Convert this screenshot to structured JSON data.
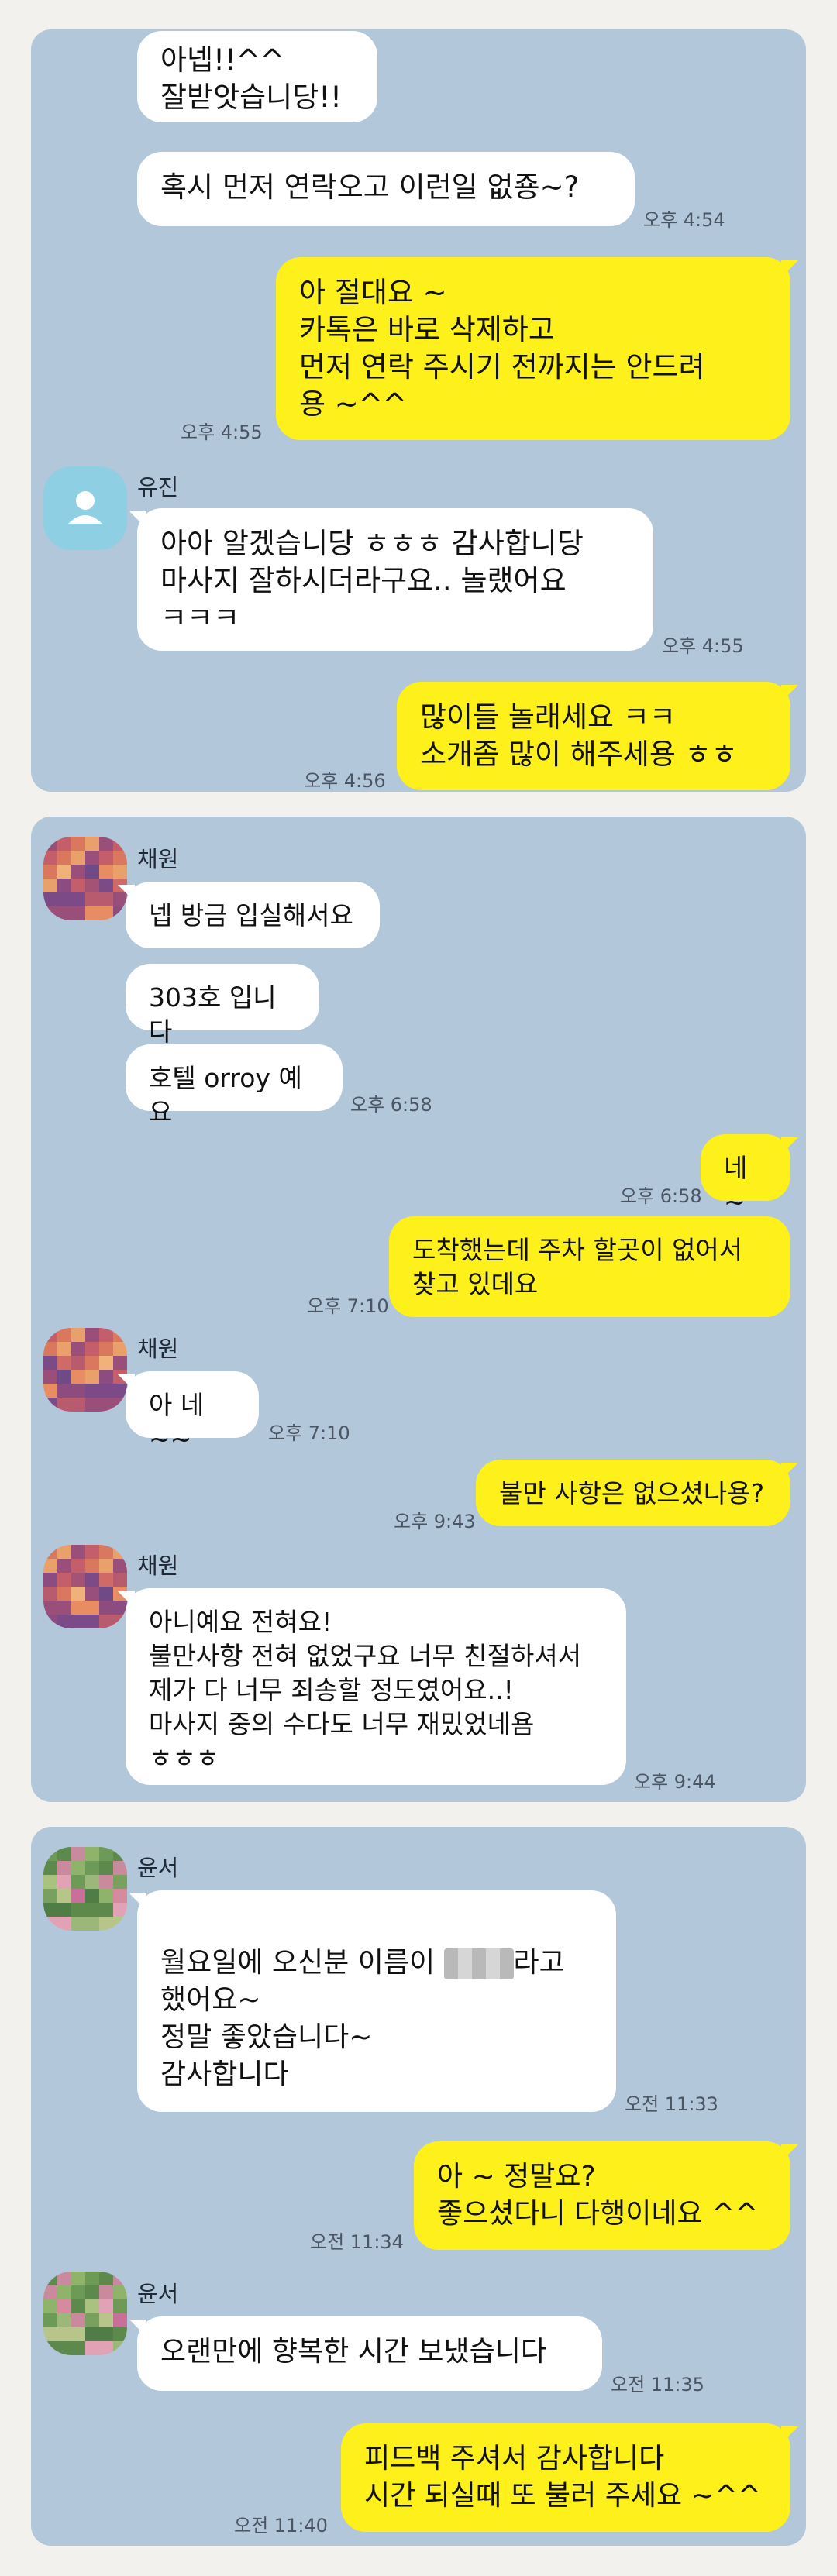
{
  "panel1": {
    "messages": [
      {
        "side": "in",
        "text": "아넵!!^^\n잘받앗습니당!!"
      },
      {
        "side": "in",
        "text": "혹시 먼저 연락오고 이런일 없죵~?",
        "time": "오후 4:54"
      },
      {
        "side": "out",
        "text": "아 절대요 ~\n카톡은 바로 삭제하고\n먼저 연락 주시기 전까지는 안드려\n용 ~^^",
        "time": "오후 4:55"
      },
      {
        "side": "in",
        "sender": "유진",
        "text": "아아 알겠습니당 ㅎㅎㅎ 감사합니당\n마사지 잘하시더라구요.. 놀랬어요\nㅋㅋㅋ",
        "time": "오후 4:55"
      },
      {
        "side": "out",
        "text": "많이들 놀래세요 ㅋㅋ\n소개좀 많이 해주세용 ㅎㅎ",
        "time": "오후 4:56"
      }
    ]
  },
  "panel2": {
    "messages": [
      {
        "side": "in",
        "sender": "채원",
        "text": "넵 방금 입실해서요"
      },
      {
        "side": "in",
        "text": "303호 입니다"
      },
      {
        "side": "in",
        "text": "호텔 orroy 예요",
        "time": "오후 6:58"
      },
      {
        "side": "out",
        "text": "네 ~",
        "time": "오후 6:58"
      },
      {
        "side": "out",
        "text": "도착했는데  주차 할곳이 없어서\n찾고 있데요",
        "time": "오후 7:10"
      },
      {
        "side": "in",
        "sender": "채원",
        "text": "아 네~~",
        "time": "오후 7:10"
      },
      {
        "side": "out",
        "text": "불만 사항은 없으셨나용?",
        "time": "오후 9:43"
      },
      {
        "side": "in",
        "sender": "채원",
        "text": "아니예요 전혀요!\n불만사항 전혀 없었구요 너무 친절하셔서\n제가 다 너무 죄송할 정도였어요..!\n마사지 중의 수다도 너무 재밌었네욤\nㅎㅎㅎ",
        "time": "오후 9:44"
      }
    ]
  },
  "panel3": {
    "messages": [
      {
        "side": "in",
        "sender": "윤서",
        "text_before": "월요일에 오신분 이름이 ",
        "text_after": "라고\n했어요~\n정말 좋았습니다~\n감사합니다",
        "time": "오전 11:33"
      },
      {
        "side": "out",
        "text": "아 ~ 정말요?\n좋으셨다니 다행이네요 ^^",
        "time": "오전 11:34"
      },
      {
        "side": "in",
        "sender": "윤서",
        "text": "오랜만에 향복한 시간 보냈습니다",
        "time": "오전 11:35"
      },
      {
        "side": "out",
        "text": "피드백 주셔서 감사합니다\n시간 되실때 또 불러 주세요 ~^^",
        "time": "오전 11:40"
      }
    ]
  },
  "colors": {
    "chat_background": "#b2c7da",
    "outgoing_bubble": "#fef01b",
    "incoming_bubble": "#ffffff",
    "page_background": "#f3f1ee"
  }
}
